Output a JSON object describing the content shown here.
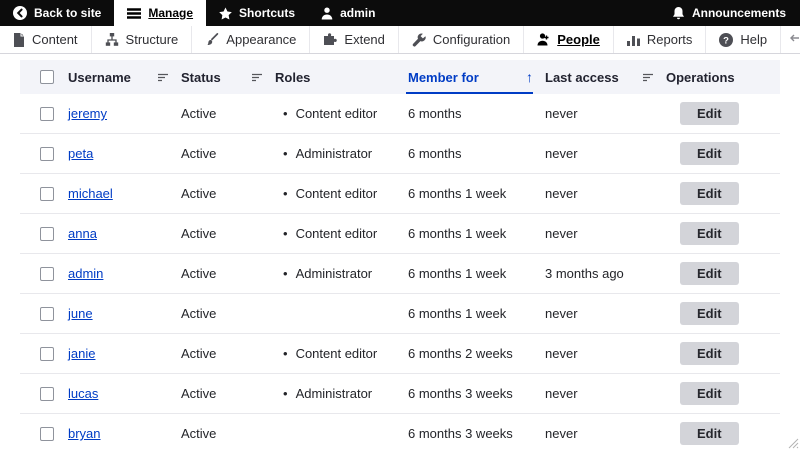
{
  "top_bar": {
    "back_to_site": "Back to site",
    "manage": "Manage",
    "shortcuts": "Shortcuts",
    "user": "admin",
    "announcements": "Announcements"
  },
  "admin_menu": {
    "items": [
      {
        "label": "Content",
        "icon": "document-icon"
      },
      {
        "label": "Structure",
        "icon": "sitemap-icon"
      },
      {
        "label": "Appearance",
        "icon": "brush-icon"
      },
      {
        "label": "Extend",
        "icon": "puzzle-icon"
      },
      {
        "label": "Configuration",
        "icon": "wrench-icon"
      },
      {
        "label": "People",
        "icon": "people-icon",
        "active": true
      },
      {
        "label": "Reports",
        "icon": "bar-chart-icon"
      },
      {
        "label": "Help",
        "icon": "help-icon"
      }
    ]
  },
  "table": {
    "columns": [
      {
        "label": "Username",
        "sort_icon": true
      },
      {
        "label": "Status",
        "sort_icon": true
      },
      {
        "label": "Roles"
      },
      {
        "label": "Member for",
        "sorted": "ascending"
      },
      {
        "label": "Last access",
        "sort_icon": true
      },
      {
        "label": "Operations"
      }
    ],
    "rows": [
      {
        "username": "jeremy",
        "status": "Active",
        "role": "Content editor",
        "member_for": "6 months",
        "last_access": "never",
        "operation": "Edit"
      },
      {
        "username": "peta",
        "status": "Active",
        "role": "Administrator",
        "member_for": "6 months",
        "last_access": "never",
        "operation": "Edit"
      },
      {
        "username": "michael",
        "status": "Active",
        "role": "Content editor",
        "member_for": "6 months 1 week",
        "last_access": "never",
        "operation": "Edit"
      },
      {
        "username": "anna",
        "status": "Active",
        "role": "Content editor",
        "member_for": "6 months 1 week",
        "last_access": "never",
        "operation": "Edit"
      },
      {
        "username": "admin",
        "status": "Active",
        "role": "Administrator",
        "member_for": "6 months 1 week",
        "last_access": "3 months ago",
        "operation": "Edit"
      },
      {
        "username": "june",
        "status": "Active",
        "role": "",
        "member_for": "6 months 1 week",
        "last_access": "never",
        "operation": "Edit"
      },
      {
        "username": "janie",
        "status": "Active",
        "role": "Content editor",
        "member_for": "6 months 2 weeks",
        "last_access": "never",
        "operation": "Edit"
      },
      {
        "username": "lucas",
        "status": "Active",
        "role": "Administrator",
        "member_for": "6 months 3 weeks",
        "last_access": "never",
        "operation": "Edit"
      },
      {
        "username": "bryan",
        "status": "Active",
        "role": "",
        "member_for": "6 months 3 weeks",
        "last_access": "never",
        "operation": "Edit"
      }
    ]
  },
  "colors": {
    "topbar_bg": "#0c0c0c",
    "accent_blue": "#003cc5",
    "table_header_bg": "#f3f4f9",
    "button_bg": "#d3d4d9"
  }
}
